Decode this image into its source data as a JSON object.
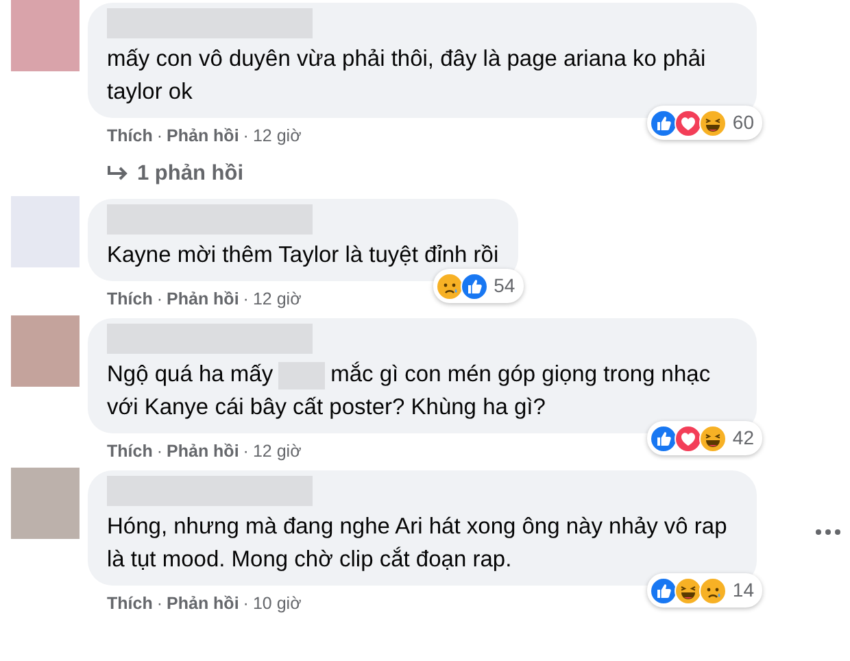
{
  "comments": [
    {
      "color": "#d9a3aa",
      "text_parts": [
        "mấy con vô duyên vừa phải thôi, đây là page ariana ko phải taylor ok"
      ],
      "reactions": [
        {
          "kind": "like"
        },
        {
          "kind": "love"
        },
        {
          "kind": "haha"
        }
      ],
      "reaction_count": "60",
      "actions": [
        "Thích",
        "Phản hồi"
      ],
      "separator": "·",
      "time": "12 giờ",
      "replies_link": "1 phản hồi",
      "more_menu": false
    },
    {
      "color": "#e6e8f2",
      "text_parts": [
        "Kayne mời thêm Taylor là tuyệt đỉnh rồi"
      ],
      "reactions": [
        {
          "kind": "sad"
        },
        {
          "kind": "like"
        }
      ],
      "reaction_count": "54",
      "actions": [
        "Thích",
        "Phản hồi"
      ],
      "separator": "·",
      "time": "12 giờ",
      "more_menu": false
    },
    {
      "color": "#c4a39c",
      "text_parts": [
        "Ngộ quá ha mấy",
        "mắc gì con mén góp giọng trong nhạc với Kanye cái bây cất poster? Khùng ha gì?"
      ],
      "reactions": [
        {
          "kind": "like"
        },
        {
          "kind": "love"
        },
        {
          "kind": "haha"
        }
      ],
      "reaction_count": "42",
      "actions": [
        "Thích",
        "Phản hồi"
      ],
      "separator": "·",
      "time": "12 giờ",
      "more_menu": false
    },
    {
      "color": "#bcb1ab",
      "text_parts": [
        "Hóng, nhưng mà đang nghe Ari hát xong ông này nhảy vô rap là tụt mood. Mong chờ clip cắt đoạn rap."
      ],
      "reactions": [
        {
          "kind": "like"
        },
        {
          "kind": "haha"
        },
        {
          "kind": "sad"
        }
      ],
      "reaction_count": "14",
      "actions": [
        "Thích",
        "Phản hồi"
      ],
      "separator": "·",
      "time": "10 giờ",
      "more_menu": true
    }
  ]
}
